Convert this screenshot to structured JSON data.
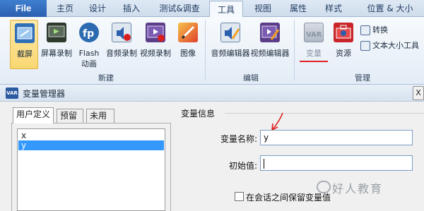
{
  "ribbon_tabs": [
    {
      "label": "File"
    },
    {
      "label": "主页"
    },
    {
      "label": "设计"
    },
    {
      "label": "插入"
    },
    {
      "label": "测试&调查"
    },
    {
      "label": "工具"
    },
    {
      "label": "视图"
    },
    {
      "label": "属性"
    },
    {
      "label": "样式"
    },
    {
      "label": "位置 & 大小"
    }
  ],
  "active_tab": "工具",
  "groups": {
    "new": {
      "label": "新建",
      "buttons": [
        {
          "label": "截屏",
          "icon": "screenshot-icon"
        },
        {
          "label": "屏幕录制",
          "icon": "screen-record-icon"
        },
        {
          "label": "Flash\n动画",
          "icon": "flash-icon"
        },
        {
          "label": "音频录制",
          "icon": "audio-record-icon"
        },
        {
          "label": "视频录制",
          "icon": "video-record-icon"
        },
        {
          "label": "图像",
          "icon": "image-icon"
        }
      ]
    },
    "edit": {
      "label": "编辑",
      "buttons": [
        {
          "label": "音频编辑器",
          "icon": "audio-editor-icon"
        },
        {
          "label": "视频编辑器",
          "icon": "video-editor-icon"
        }
      ]
    },
    "manage": {
      "label": "管理",
      "buttons": [
        {
          "label": "变量",
          "icon": "variable-icon"
        },
        {
          "label": "资源",
          "icon": "resource-icon"
        }
      ],
      "small_buttons": [
        {
          "label": "转换",
          "icon": "convert-icon"
        },
        {
          "label": "文本大小工具",
          "icon": "text-size-icon"
        }
      ]
    }
  },
  "dialog": {
    "title": "变量管理器",
    "close_label": "X",
    "tabs": [
      {
        "label": "用户定义"
      },
      {
        "label": "预留"
      },
      {
        "label": "未用"
      }
    ],
    "variables": [
      "x",
      "y"
    ],
    "selected_variable": "y",
    "group_title": "变量信息",
    "name_label": "变量名称:",
    "name_value": "y",
    "init_label": "初始值:",
    "init_value": "",
    "keep_checkbox_label": "在会话之间保留变量值",
    "keep_checked": false
  },
  "watermark": "好人教育",
  "colors": {
    "selection": "#3399ff",
    "annotation_red": "#e02020",
    "file_tab": "#2a5fae"
  }
}
